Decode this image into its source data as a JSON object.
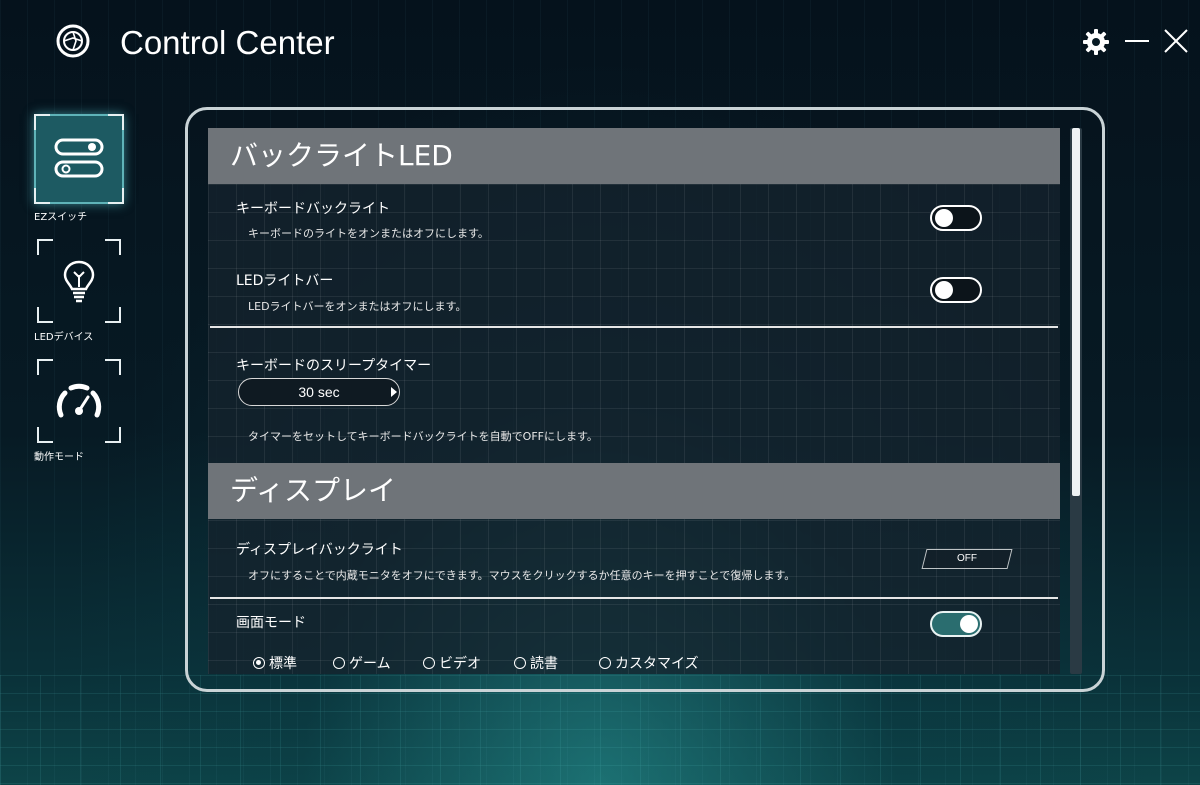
{
  "app": {
    "title": "Control Center"
  },
  "window_controls": {
    "settings_icon": "gear-icon",
    "minimize_icon": "minimize-icon",
    "close_icon": "close-icon"
  },
  "sidebar": {
    "items": [
      {
        "label": "EZスイッチ",
        "icon": "toggle-switch-icon",
        "active": true
      },
      {
        "label": "LEDデバイス",
        "icon": "light-bulb-icon",
        "active": false
      },
      {
        "label": "動作モード",
        "icon": "speedometer-icon",
        "active": false
      }
    ]
  },
  "backlight": {
    "header": "バックライトLED",
    "keyboard_backlight": {
      "title": "キーボードバックライト",
      "desc": "キーボードのライトをオンまたはオフにします。",
      "state": "off"
    },
    "led_lightbar": {
      "title": "LEDライトバー",
      "desc": "LEDライトバーをオンまたはオフにします。",
      "state": "off"
    },
    "sleep_timer": {
      "title": "キーボードのスリープタイマー",
      "value": "30 sec",
      "desc": "タイマーをセットしてキーボードバックライトを自動でOFFにします。"
    }
  },
  "display": {
    "header": "ディスプレイ",
    "display_backlight": {
      "title": "ディスプレイバックライト",
      "desc": "オフにすることで内蔵モニタをオフにできます。マウスをクリックするか任意のキーを押すことで復帰します。",
      "button": "OFF"
    },
    "screen_mode": {
      "title": "画面モード",
      "state": "on",
      "options": [
        "標準",
        "ゲーム",
        "ビデオ",
        "読書",
        "カスタマイズ"
      ],
      "selected": "標準"
    }
  },
  "colors": {
    "accent": "#2a6d6f",
    "header_bar": "#6f7479",
    "frame": "#c9d3d6"
  }
}
